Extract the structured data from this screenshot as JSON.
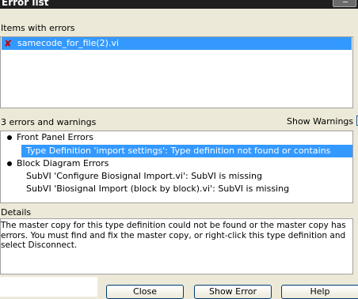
{
  "window": {
    "title": "Error list"
  },
  "items": {
    "header": "Items with errors",
    "list": [
      {
        "name": "samecode_for_file(2).vi",
        "icon": "error-x-icon"
      }
    ]
  },
  "errors": {
    "summary": "3 errors and warnings",
    "show_warnings_label": "Show Warnings",
    "show_warnings_checked": false,
    "groups": [
      {
        "title": "Front Panel Errors",
        "entries": [
          "Type Definition 'import settings': Type definition not found or contains errors"
        ]
      },
      {
        "title": "Block Diagram Errors",
        "entries": [
          "SubVI 'Configure Biosignal Import.vi': SubVI is missing",
          "SubVI 'Biosignal Import (block by block).vi': SubVI is missing"
        ]
      }
    ]
  },
  "details": {
    "header": "Details",
    "text": "The master copy for this type definition could not be found or the master copy has errors. You must find and fix the master copy, or right-click this type definition and select Disconnect."
  },
  "buttons": {
    "close": "Close",
    "show_error": "Show Error",
    "help": "Help"
  },
  "colors": {
    "selection": "#3399ff",
    "dialog_bg": "#ece9d8",
    "error_icon": "#c00000"
  }
}
